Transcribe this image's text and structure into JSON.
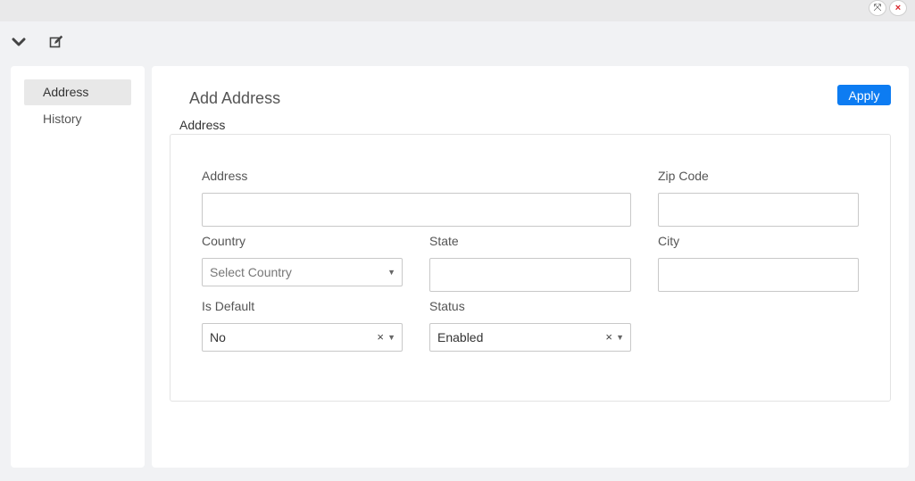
{
  "window": {
    "expand_icon": "⤧",
    "close_icon": "×"
  },
  "toolbar": {
    "collapse_icon": "chevron-down-icon",
    "edit_icon": "edit-icon"
  },
  "sidebar": {
    "items": [
      {
        "label": "Address",
        "active": true
      },
      {
        "label": "History",
        "active": false
      }
    ]
  },
  "main": {
    "title": "Add Address",
    "apply_label": "Apply",
    "section_title": "Address"
  },
  "form": {
    "address": {
      "label": "Address",
      "value": ""
    },
    "zip": {
      "label": "Zip Code",
      "value": ""
    },
    "country": {
      "label": "Country",
      "placeholder": "Select Country"
    },
    "state": {
      "label": "State",
      "value": ""
    },
    "city": {
      "label": "City",
      "value": ""
    },
    "is_default": {
      "label": "Is Default",
      "value": "No",
      "clear": "×"
    },
    "status": {
      "label": "Status",
      "value": "Enabled",
      "clear": "×"
    }
  },
  "colors": {
    "accent": "#0d7cf2",
    "close": "#d9262c",
    "page_bg": "#f1f2f4"
  }
}
